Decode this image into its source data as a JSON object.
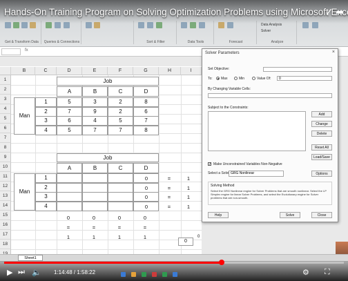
{
  "video": {
    "title": "Hands-On Training Program on Solving Optimization Problems using Microsoft Excel and Solver - Day...",
    "time": "1:14:48 / 1:58:22",
    "progress": 0.64
  },
  "ribbon": {
    "groups": [
      "Get & Transform Data",
      "Queries & Connections",
      "Sort & Filter",
      "Data Tools",
      "Forecast",
      "Analyze"
    ],
    "right_items": [
      "Data Analysis",
      "Solver"
    ]
  },
  "formula_bar": {
    "fx": "fx"
  },
  "columns": [
    "A",
    "B",
    "C",
    "D",
    "E",
    "F",
    "G",
    "H",
    "I"
  ],
  "rows": [
    "1",
    "2",
    "3",
    "4",
    "5",
    "6",
    "7",
    "8",
    "9",
    "10",
    "11",
    "12",
    "13",
    "14",
    "15",
    "16",
    "17",
    "18",
    "19"
  ],
  "table1": {
    "header": "Job",
    "job_cols": [
      "A",
      "B",
      "C",
      "D"
    ],
    "row_label": "Man",
    "men": [
      "1",
      "2",
      "3",
      "4"
    ],
    "values": [
      [
        "5",
        "3",
        "2",
        "8"
      ],
      [
        "7",
        "9",
        "2",
        "6"
      ],
      [
        "6",
        "4",
        "5",
        "7"
      ],
      [
        "5",
        "7",
        "7",
        "8"
      ]
    ]
  },
  "table2": {
    "header": "Job",
    "job_cols": [
      "A",
      "B",
      "C",
      "D"
    ],
    "row_label": "Man",
    "men": [
      "1",
      "2",
      "3",
      "4"
    ],
    "row_sums": [
      "0",
      "0",
      "0",
      "0"
    ],
    "eq": "=",
    "rhs": [
      "1",
      "1",
      "1",
      "1"
    ],
    "col_sums": [
      "0",
      "0",
      "0",
      "0"
    ],
    "col_eq": [
      "=",
      "=",
      "=",
      "="
    ],
    "col_rhs": [
      "1",
      "1",
      "1",
      "1"
    ],
    "objective": "0",
    "objective_side": "0"
  },
  "sheet_tab": "Sheet1",
  "dialog": {
    "title": "Solver Parameters",
    "close": "×",
    "set_objective": "Set Objective:",
    "to": "To:",
    "radio_max": "Max",
    "radio_min": "Min",
    "radio_value": "Value Of:",
    "value_of": "0",
    "changing": "By Changing Variable Cells:",
    "constraints": "Subject to the Constraints:",
    "buttons": [
      "Add",
      "Change",
      "Delete",
      "Reset All",
      "Load/Save"
    ],
    "nonneg": "Make Unconstrained Variables Non-Negative",
    "method_label": "Select a Solving Method:",
    "method": "GRG Nonlinear",
    "options": "Options",
    "solving_method_title": "Solving Method",
    "solving_method_desc": "Select the GRG Nonlinear engine for Solver Problems that are smooth nonlinear. Select the LP Simplex engine for linear Solver Problems, and select the Evolutionary engine for Solver problems that are non-smooth.",
    "help": "Help",
    "solve": "Solve",
    "close_btn": "Close"
  }
}
